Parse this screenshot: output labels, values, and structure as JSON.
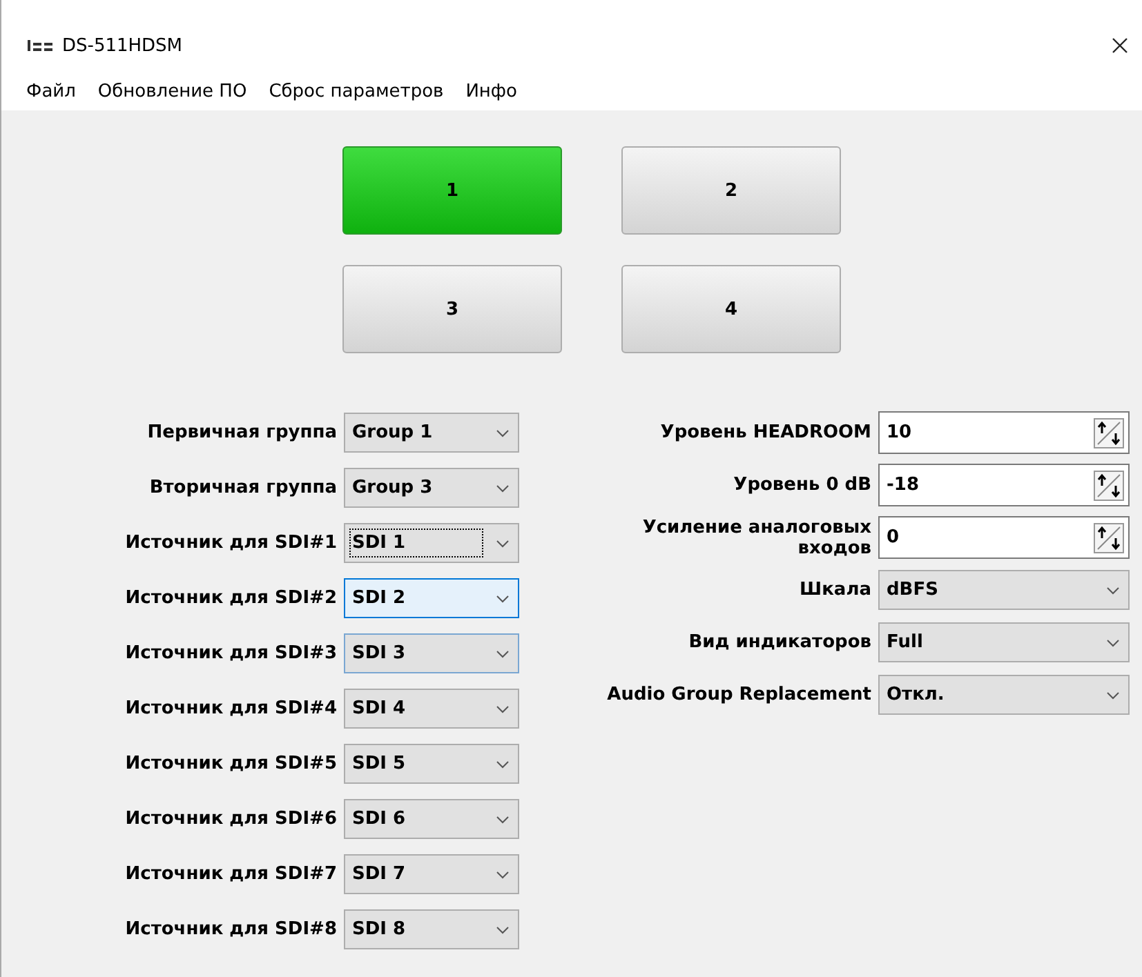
{
  "window": {
    "title": "DS-511HDSM"
  },
  "menu": [
    "Файл",
    "Обновление ПО",
    "Сброс параметров",
    "Инфо"
  ],
  "channel_buttons": [
    {
      "label": "1",
      "selected": true
    },
    {
      "label": "2",
      "selected": false
    },
    {
      "label": "3",
      "selected": false
    },
    {
      "label": "4",
      "selected": false
    }
  ],
  "left_fields": [
    {
      "label": "Первичная группа",
      "value": "Group 1",
      "focused": false,
      "hovered": false,
      "highlighted": false
    },
    {
      "label": "Вторичная группа",
      "value": "Group 3",
      "focused": false,
      "hovered": false,
      "highlighted": false
    },
    {
      "label": "Источник для SDI#1",
      "value": "SDI 1",
      "focused": true,
      "hovered": false,
      "highlighted": false
    },
    {
      "label": "Источник для SDI#2",
      "value": "SDI 2",
      "focused": false,
      "hovered": true,
      "highlighted": false
    },
    {
      "label": "Источник для SDI#3",
      "value": "SDI 3",
      "focused": false,
      "hovered": false,
      "highlighted": true
    },
    {
      "label": "Источник для SDI#4",
      "value": "SDI 4",
      "focused": false,
      "hovered": false,
      "highlighted": false
    },
    {
      "label": "Источник для SDI#5",
      "value": "SDI 5",
      "focused": false,
      "hovered": false,
      "highlighted": false
    },
    {
      "label": "Источник для SDI#6",
      "value": "SDI 6",
      "focused": false,
      "hovered": false,
      "highlighted": false
    },
    {
      "label": "Источник для SDI#7",
      "value": "SDI 7",
      "focused": false,
      "hovered": false,
      "highlighted": false
    },
    {
      "label": "Источник для SDI#8",
      "value": "SDI 8",
      "focused": false,
      "hovered": false,
      "highlighted": false
    }
  ],
  "right_fields": [
    {
      "kind": "spin",
      "label": "Уровень HEADROOM",
      "value": "10"
    },
    {
      "kind": "spin",
      "label": "Уровень 0 dB",
      "value": "-18"
    },
    {
      "kind": "spin",
      "label": "Усиление аналоговых входов",
      "value": "0"
    },
    {
      "kind": "select",
      "label": "Шкала",
      "value": "dBFS"
    },
    {
      "kind": "select",
      "label": "Вид индикаторов",
      "value": "Full"
    },
    {
      "kind": "select",
      "label": "Audio Group Replacement",
      "value": "Откл."
    }
  ]
}
